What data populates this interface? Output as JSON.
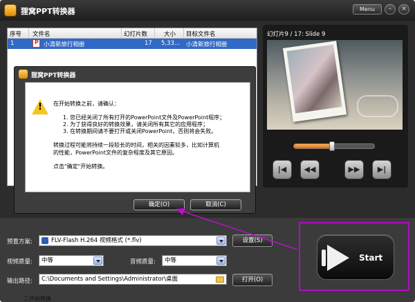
{
  "window": {
    "title": "狸窝PPT转换器",
    "menu_label": "Menu",
    "minimize_label": "–",
    "close_label": "×"
  },
  "file_list": {
    "columns": [
      "序号",
      "文件名",
      "幻灯片数",
      "大小",
      "目标文件名"
    ],
    "rows": [
      {
        "index": "1",
        "filename": "小清新旅行相册",
        "slides": "17",
        "size": "5,33...",
        "target": "小清新旅行相册"
      }
    ]
  },
  "preview": {
    "slide_label": "幻灯片9 / 17: Slide 9",
    "progress_fraction": 0.47,
    "buttons": {
      "prev": "|◀",
      "rewind": "◀◀",
      "forward": "▶▶",
      "next": "▶|"
    }
  },
  "options": {
    "preset_label": "预置方案:",
    "preset_value": "FLV-Flash H.264 视频格式 (*.flv)",
    "settings_button": "设置(S)",
    "video_quality_label": "视频质量:",
    "video_quality_value": "中等",
    "audio_quality_label": "音频质量:",
    "audio_quality_value": "中等",
    "output_path_label": "输出路径:",
    "output_path_value": "C:\\Documents and Settings\\Administrator\\桌面",
    "open_button": "打开(O)",
    "start_button": "Start"
  },
  "dialog": {
    "title": "狸窝PPT转换器",
    "intro": "在开始转换之前，请确认：",
    "items": [
      "1.   您已经关闭了所有打开的PowerPoint文件及PowerPoint程序；",
      "2.   为了获得良好的转换效果，请关闭所有其它的应用程序；",
      "3.   在转换期间请不要打开或关闭PowerPoint，否则将会失败。"
    ],
    "note_line1": "转换过程可能将持续一段较长的时间，相关的因素较多，比如计算机",
    "note_line2": "的性能，PowerPoint文件的复杂程度及其它原因。",
    "footer": "点击\"确定\"开始转换。",
    "ok_button": "确定(O)",
    "cancel_button": "取消(C)"
  },
  "bottom_caption": "二开始转换"
}
